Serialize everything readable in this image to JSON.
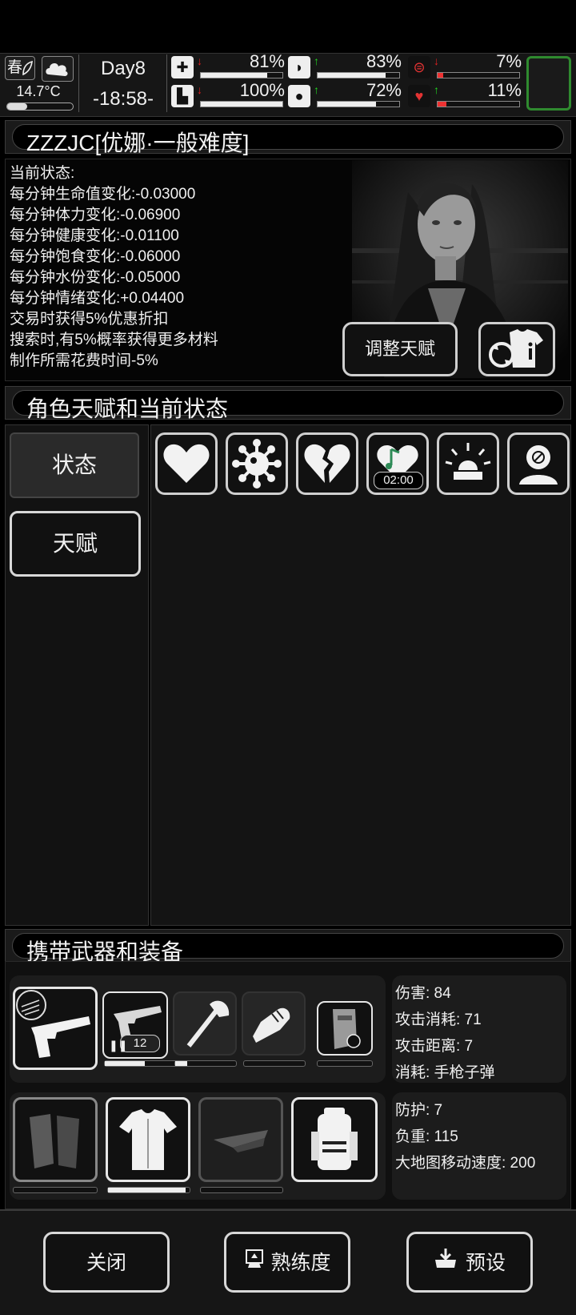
{
  "header": {
    "season": "春",
    "temperature": "14.7°C",
    "temperature_level": 0.3,
    "day": "Day8",
    "clock": "-18:58-",
    "stats": [
      {
        "name": "health",
        "icon": "medkit-icon",
        "trend": "down",
        "value_text": "81%",
        "value": 81
      },
      {
        "name": "food",
        "icon": "stomach-icon",
        "trend": "up",
        "value_text": "83%",
        "value": 83
      },
      {
        "name": "infection",
        "icon": "mask-icon",
        "trend": "down",
        "value_text": "7%",
        "value": 7
      },
      {
        "name": "stamina",
        "icon": "boot-icon",
        "trend": "down",
        "value_text": "100%",
        "value": 100
      },
      {
        "name": "water",
        "icon": "water-drop-icon",
        "trend": "up",
        "value_text": "72%",
        "value": 72
      },
      {
        "name": "mood",
        "icon": "heart-icon",
        "trend": "up",
        "value_text": "11%",
        "value": 11
      }
    ],
    "colors": {
      "up": "#22d322",
      "down": "#e02020",
      "warn": "#e33333",
      "slot_border": "#2f8a2f"
    }
  },
  "character": {
    "title": "ZZZJC[优娜·一般难度]",
    "effects": [
      "当前状态:",
      "每分钟生命值变化:-0.03000",
      "每分钟体力变化:-0.06900",
      "每分钟健康变化:-0.01100",
      "每分钟饱食变化:-0.06000",
      "每分钟水份变化:-0.05000",
      "每分钟情绪变化:+0.04400",
      "交易时获得5%优惠折扣",
      "搜索时,有5%概率获得更多材料",
      "制作所需花费时间-5%"
    ],
    "adjust_talent_label": "调整天赋"
  },
  "talents_section": {
    "title": "角色天赋和当前状态",
    "tabs": {
      "state": "状态",
      "talent": "天赋"
    },
    "status_icons": [
      "heart-icon",
      "virus-icon",
      "broken-heart-icon",
      "music-heart-icon",
      "alarm-icon",
      "head-icon"
    ],
    "timer": "02:00"
  },
  "equipment_section": {
    "title": "携带武器和装备",
    "weapon_durability": [
      0.4,
      0.2,
      0,
      0
    ],
    "armor_durability": [
      0,
      0.95,
      0
    ],
    "ammo_count": "12",
    "weapon_stats": [
      "伤害: 84",
      "攻击消耗: 71",
      "攻击距离: 7",
      "消耗: 手枪子弹"
    ],
    "armor_stats": [
      "防护: 7",
      "负重: 115",
      "大地图移动速度: 200"
    ]
  },
  "bottom_bar": {
    "close": "关闭",
    "proficiency": "熟练度",
    "preset": "预设"
  }
}
